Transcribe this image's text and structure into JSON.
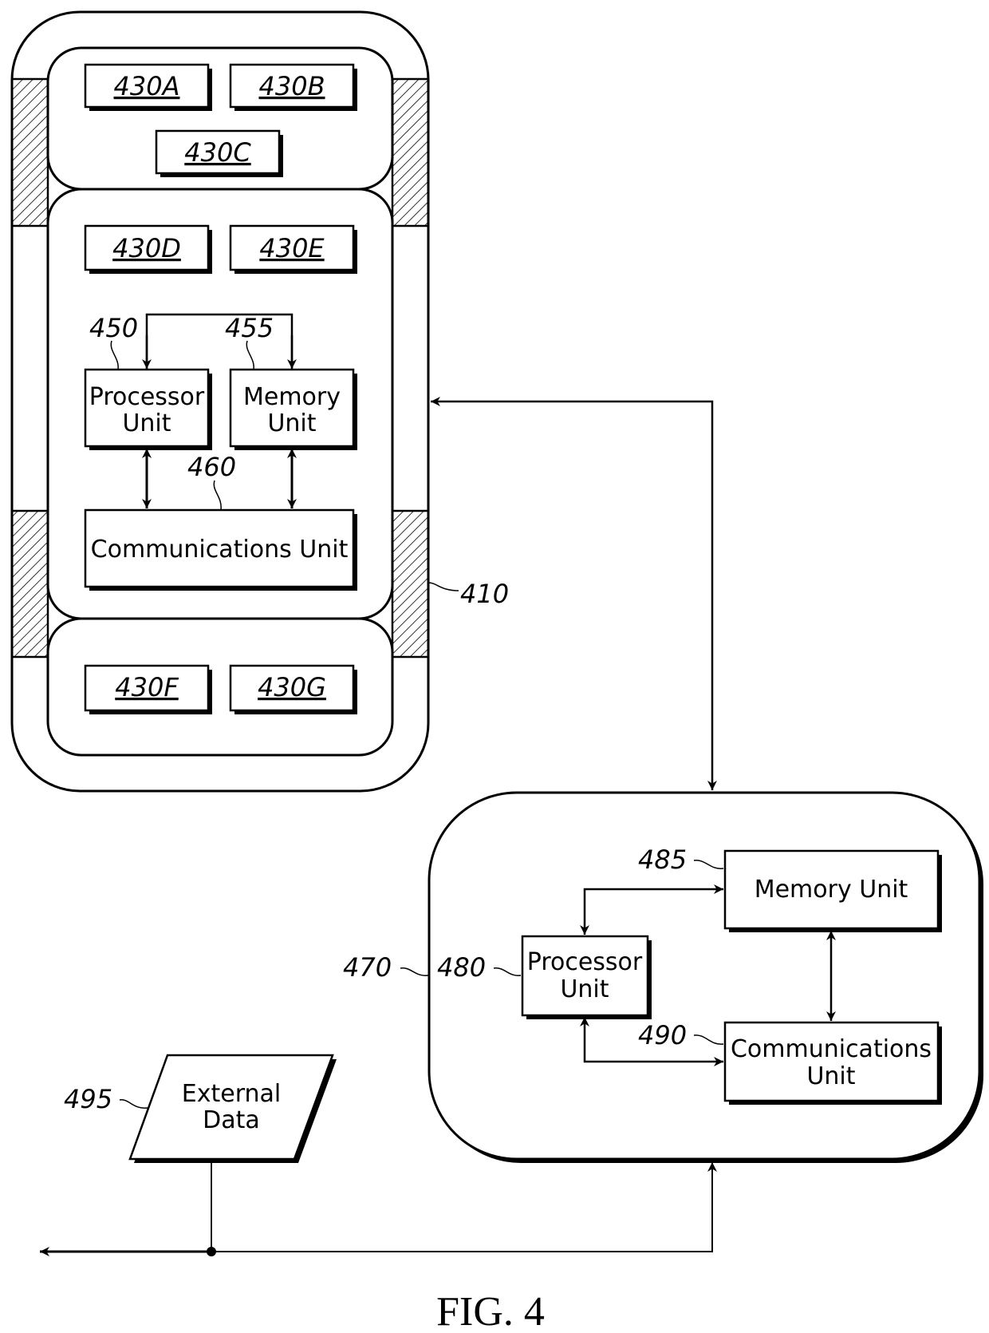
{
  "figure": {
    "caption": "FIG. 4",
    "device": {
      "ref": "410",
      "modules": [
        "430A",
        "430B",
        "430C",
        "430D",
        "430E",
        "430F",
        "430G"
      ],
      "processor": {
        "ref": "450",
        "label_lines": [
          "Processor",
          "Unit"
        ]
      },
      "memory": {
        "ref": "455",
        "label_lines": [
          "Memory",
          "Unit"
        ]
      },
      "comms": {
        "ref": "460",
        "label": "Communications Unit"
      }
    },
    "server": {
      "ref": "470",
      "processor": {
        "ref": "480",
        "label_lines": [
          "Processor",
          "Unit"
        ]
      },
      "memory": {
        "ref": "485",
        "label": "Memory Unit"
      },
      "comms": {
        "ref": "490",
        "label_lines": [
          "Communications",
          "Unit"
        ]
      }
    },
    "external": {
      "ref": "495",
      "label_lines": [
        "External",
        "Data"
      ]
    }
  }
}
